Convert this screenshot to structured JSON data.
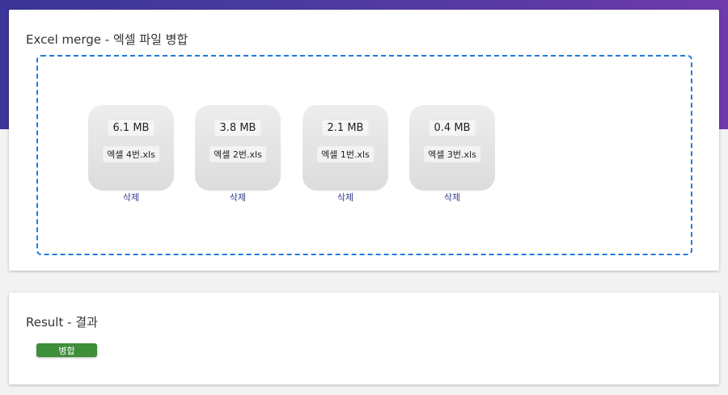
{
  "upload": {
    "title": "Excel merge - 엑셀 파일 병합",
    "files": [
      {
        "size": "6.1 MB",
        "name": "엑셀 4번.xls",
        "remove_label": "삭제"
      },
      {
        "size": "3.8 MB",
        "name": "엑셀 2번.xls",
        "remove_label": "삭제"
      },
      {
        "size": "2.1 MB",
        "name": "엑셀 1번.xls",
        "remove_label": "삭제"
      },
      {
        "size": "0.4 MB",
        "name": "엑셀 3번.xls",
        "remove_label": "삭제"
      }
    ]
  },
  "result": {
    "title": "Result - 결과",
    "merge_label": "병합"
  },
  "colors": {
    "banner_start": "#3b3597",
    "banner_end": "#6f3aab",
    "dropzone_border": "#1e7be0",
    "link": "#2d3a8c",
    "merge_button": "#3e8e3a"
  }
}
